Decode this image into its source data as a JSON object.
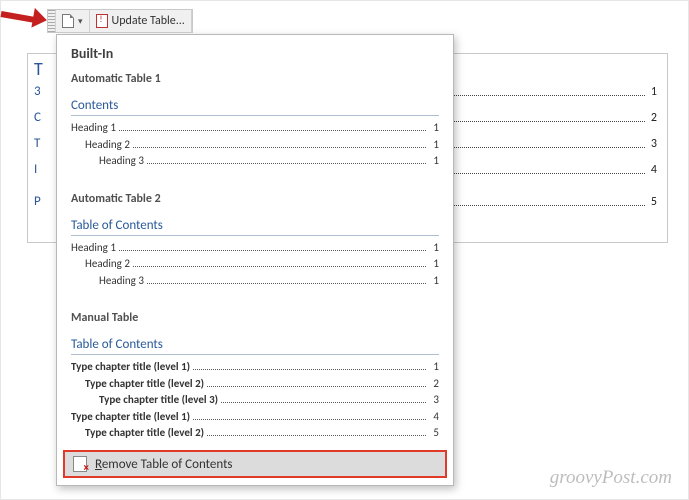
{
  "toolbar": {
    "update_label": "Update Table..."
  },
  "panel": {
    "builtin_label": "Built-In",
    "auto1": {
      "title": "Automatic Table 1",
      "toc_title": "Contents",
      "rows": [
        {
          "label": "Heading 1",
          "page": "1",
          "indent": 0
        },
        {
          "label": "Heading 2",
          "page": "1",
          "indent": 1
        },
        {
          "label": "Heading 3",
          "page": "1",
          "indent": 2
        }
      ]
    },
    "auto2": {
      "title": "Automatic Table 2",
      "toc_title": "Table of Contents",
      "rows": [
        {
          "label": "Heading 1",
          "page": "1",
          "indent": 0
        },
        {
          "label": "Heading 2",
          "page": "1",
          "indent": 1
        },
        {
          "label": "Heading 3",
          "page": "1",
          "indent": 2
        }
      ]
    },
    "manual": {
      "title": "Manual Table",
      "toc_title": "Table of Contents",
      "rows": [
        {
          "label": "Type chapter title (level 1)",
          "page": "1",
          "indent": 0
        },
        {
          "label": "Type chapter title (level 2)",
          "page": "2",
          "indent": 1
        },
        {
          "label": "Type chapter title (level 3)",
          "page": "3",
          "indent": 2
        },
        {
          "label": "Type chapter title (level 1)",
          "page": "4",
          "indent": 0
        },
        {
          "label": "Type chapter title (level 2)",
          "page": "5",
          "indent": 1
        }
      ]
    },
    "remove_label": "Remove Table of Contents"
  },
  "doc_background": {
    "title_stub": "T",
    "left_stubs": [
      "3",
      "C",
      "T",
      "I",
      "P"
    ],
    "right_rows": [
      {
        "page": "1"
      },
      {
        "page": "2"
      },
      {
        "page": "3"
      },
      {
        "page": "4"
      },
      {
        "page": "5"
      }
    ]
  },
  "watermark": "groovyPost.com"
}
